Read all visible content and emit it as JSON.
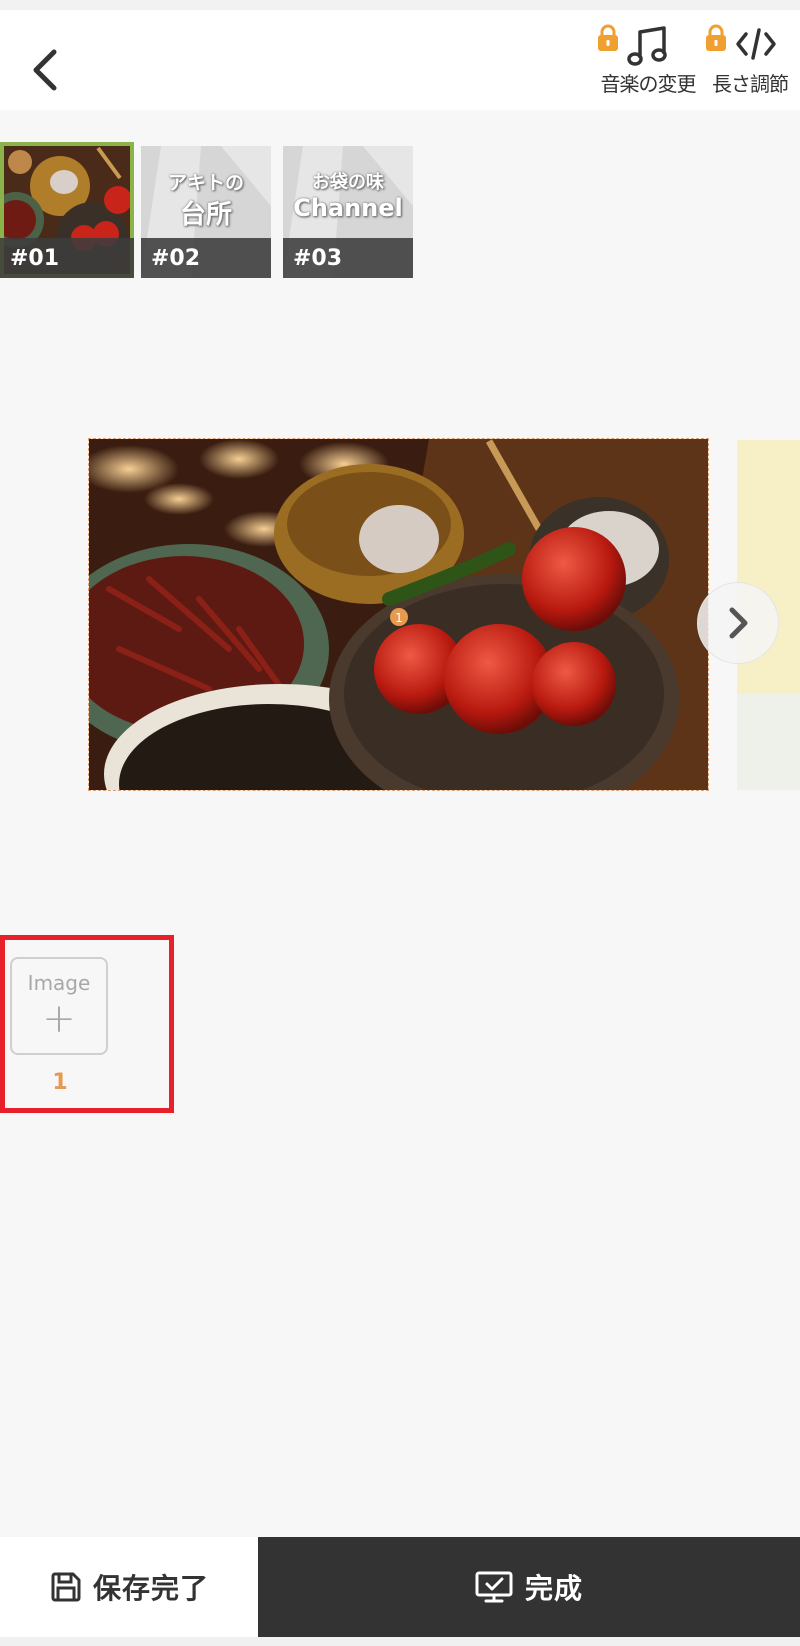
{
  "header": {
    "music_label": "音楽の変更",
    "length_label": "長さ調節"
  },
  "thumbnails": [
    {
      "badge": "#01",
      "selected": true
    },
    {
      "badge": "#02",
      "line1": "アキトの",
      "line2": "台所",
      "selected": false
    },
    {
      "badge": "#03",
      "line1": "お袋の味",
      "line2": "Channel",
      "selected": false
    }
  ],
  "canvas": {
    "marker_number": "1"
  },
  "image_slot": {
    "title": "Image",
    "plus": "+",
    "number": "1"
  },
  "footer": {
    "save_label": "保存完了",
    "done_label": "完成"
  },
  "colors": {
    "accent": "#e59a50",
    "selected_border": "#8bb34a",
    "highlight": "#e8202a",
    "dark_bar": "#333333"
  }
}
